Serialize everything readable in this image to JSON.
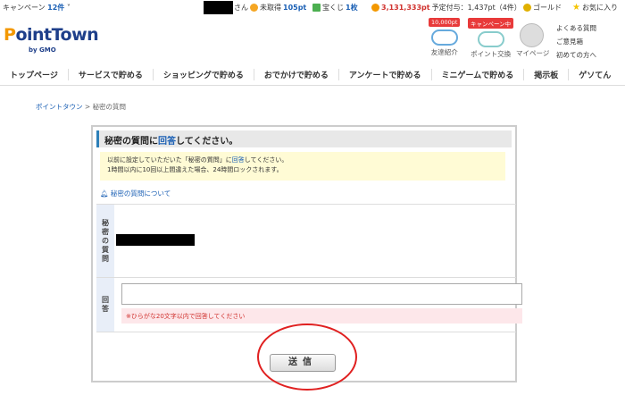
{
  "topbar": {
    "campaign": "キャンペーン",
    "campaign_count": "12件",
    "user_suffix": "さん",
    "unclaimed_label": "未取得",
    "unclaimed_value": "105pt",
    "lottery_label": "宝くじ",
    "lottery_value": "1枚",
    "points": "3,131,333pt",
    "scheduled_label": "予定付与：1,437pt（4件）",
    "gold": "ゴールド",
    "favorites": "お気に入り"
  },
  "brand": {
    "logo": "PointTown",
    "logo_first": "P",
    "logo_rest": "ointTown",
    "sub": "by GMO"
  },
  "header": {
    "badge1": "10,000pt",
    "badge2": "キャンペーン中",
    "friend": "友達紹介",
    "exchange": "ポイント交換",
    "mypage": "マイページ",
    "links": [
      "よくある質問",
      "ご意見箱",
      "初めての方へ"
    ]
  },
  "nav": [
    "トップページ",
    "サービスで貯める",
    "ショッピングで貯める",
    "おでかけで貯める",
    "アンケートで貯める",
    "ミニゲームで貯める",
    "掲示板",
    "ゲソてん"
  ],
  "breadcrumb": {
    "home": "ポイントタウン",
    "current": "秘密の質問"
  },
  "form": {
    "title_pre": "秘密の質問に",
    "title_hl": "回答",
    "title_post": "してください。",
    "notice_line1_pre": "以前に設定していただいた「秘密の質問」に",
    "notice_line1_hl": "回答",
    "notice_line1_post": "してください。",
    "notice_line2": "1時間以内に10回以上間違えた場合、24時間ロックされます。",
    "help_link": "秘密の質問について",
    "question_label": "秘密の質問",
    "answer_label": "回答",
    "answer_value": "",
    "hint": "※ひらがな20文字以内で回答してください",
    "submit": "送信"
  },
  "colors": {
    "accent": "#1a5fb4",
    "warning": "#d0312d",
    "highlight_ring": "#e02020"
  }
}
